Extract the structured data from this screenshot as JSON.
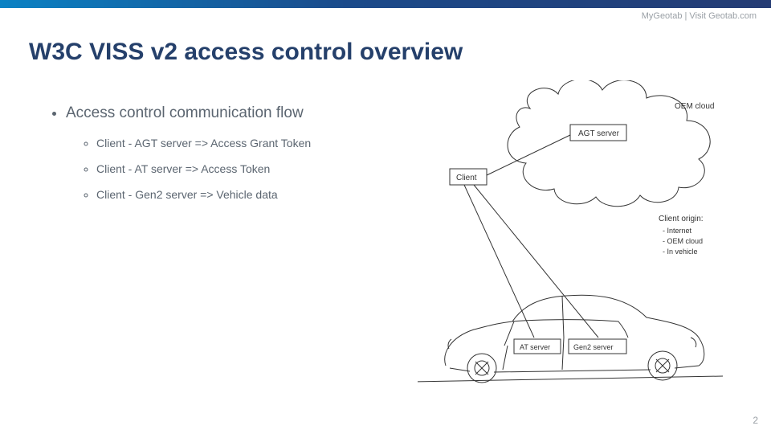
{
  "header": {
    "link_text": "MyGeotab | Visit Geotab.com"
  },
  "title": "W3C VISS v2 access control overview",
  "bullets": {
    "main": "Access control communication flow",
    "subs": [
      "Client - AGT server => Access Grant Token",
      "Client - AT server => Access Token",
      "Client - Gen2 server => Vehicle data"
    ]
  },
  "diagram": {
    "cloud_label": "OEM cloud",
    "agt_server": "AGT server",
    "client": "Client",
    "at_server": "AT server",
    "gen2_server": "Gen2 server",
    "origin_title": "Client origin:",
    "origin_items": [
      "- Internet",
      "- OEM cloud",
      "- In vehicle"
    ]
  },
  "page_number": "2"
}
